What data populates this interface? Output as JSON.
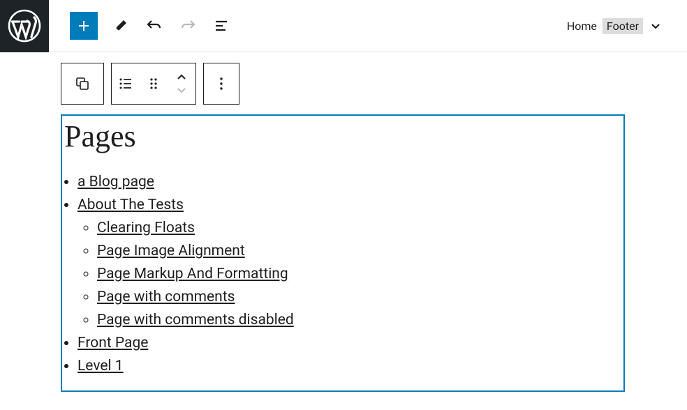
{
  "breadcrumb": {
    "parent": "Home",
    "current": "Footer"
  },
  "block": {
    "heading": "Pages",
    "pages": {
      "item0": "a Blog page",
      "item1": "About The Tests",
      "item1_children": {
        "c0": "Clearing Floats",
        "c1": "Page Image Alignment",
        "c2": "Page Markup And Formatting",
        "c3": "Page with comments",
        "c4": "Page with comments disabled"
      },
      "item2": "Front Page",
      "item3": "Level 1"
    }
  }
}
